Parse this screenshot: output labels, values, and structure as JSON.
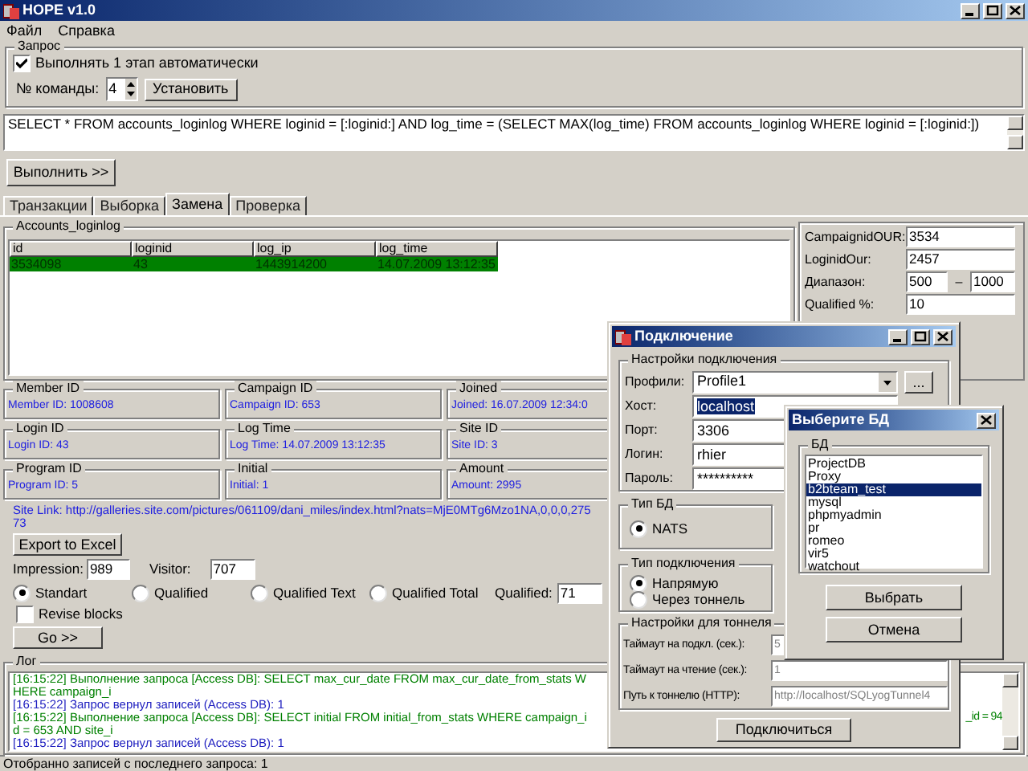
{
  "window": {
    "title": "HOPE v1.0"
  },
  "menu": [
    "Файл",
    "Справка"
  ],
  "query": {
    "group_title": "Запрос",
    "auto_run": {
      "label": "Выполнять 1 этап автоматически",
      "checked": true
    },
    "command_label": "№ команды:",
    "command_value": "4",
    "set_button": "Установить",
    "sql": "SELECT * FROM accounts_loginlog WHERE loginid = [:loginid:] AND log_time = (SELECT MAX(log_time) FROM accounts_loginlog WHERE loginid = [:loginid:])",
    "run_button": "Выполнить >>"
  },
  "tabs": [
    {
      "label": "Транзакции",
      "selected": false
    },
    {
      "label": "Выборка",
      "selected": false
    },
    {
      "label": "Замена",
      "selected": true
    },
    {
      "label": "Проверка",
      "selected": false
    }
  ],
  "table": {
    "title": "Accounts_loginlog",
    "columns": [
      "id",
      "loginid",
      "log_ip",
      "log_time"
    ],
    "rows": [
      {
        "cells": [
          "3534098",
          "43",
          "1443914200",
          "14.07.2009 13:12:35"
        ],
        "selected": true
      }
    ]
  },
  "right_fields": [
    {
      "label": "CampaignidOUR:",
      "value": "3534"
    },
    {
      "label": "LoginidOur:",
      "value": "2457"
    },
    {
      "label": "Диапазон:",
      "value": "500",
      "separator": "–",
      "value2": "1000"
    },
    {
      "label": "Qualified %:",
      "value": "10"
    }
  ],
  "info_groups": [
    {
      "title": "Member ID",
      "text": "Member ID: 1008608"
    },
    {
      "title": "Campaign ID",
      "text": "Campaign ID: 653"
    },
    {
      "title": "Joined",
      "text": "Joined: 16.07.2009 12:34:0"
    },
    {
      "title": "Login ID",
      "text": "Login ID: 43"
    },
    {
      "title": "Log Time",
      "text": "Log Time: 14.07.2009 13:12:35"
    },
    {
      "title": "Site ID",
      "text": "Site ID: 3"
    },
    {
      "title": "Program ID",
      "text": "Program ID: 5"
    },
    {
      "title": "Initial",
      "text": "Initial: 1"
    },
    {
      "title": "Amount",
      "text": "Amount: 2995"
    }
  ],
  "site_link": "Site Link: http://galleries.site.com/pictures/061109/dani_miles/index.html?nats=MjE0MTg6Mzo1NA,0,0,0,27573",
  "export_button": "Export to Excel",
  "impression": {
    "label": "Impression:",
    "value": "989"
  },
  "visitor": {
    "label": "Visitor:",
    "value": "707"
  },
  "modes": [
    {
      "label": "Standart",
      "selected": true
    },
    {
      "label": "Qualified",
      "selected": false
    },
    {
      "label": "Qualified Text",
      "selected": false
    },
    {
      "label": "Qualified Total",
      "selected": false
    }
  ],
  "qualified": {
    "label": "Qualified:",
    "value": "71"
  },
  "revise": {
    "label": "Revise blocks",
    "checked": false
  },
  "go_button": "Go >>",
  "log": {
    "title": "Лог",
    "lines": [
      {
        "kind": "query",
        "text": "[16:15:22] Выполнение запроса [Access DB]: SELECT max_cur_date FROM max_cur_date_from_stats WHERE campaign_i"
      },
      {
        "kind": "result",
        "text": "[16:15:22] Запрос вернул записей (Access DB): 1"
      },
      {
        "kind": "query",
        "text": "[16:15:22] Выполнение запроса [Access DB]: SELECT initial FROM initial_from_stats WHERE campaign_id = 653 AND site_i",
        "tail": "_id = 94"
      },
      {
        "kind": "result",
        "text": "[16:15:22] Запрос вернул записей (Access DB): 1"
      }
    ]
  },
  "status_bar": "Отобранно записей с последнего запроса: 1",
  "connect_dialog": {
    "title": "Подключение",
    "settings_title": "Настройки подключения",
    "fields": [
      {
        "label": "Профили:",
        "value": "Profile1",
        "kind": "combo",
        "selected": false
      },
      {
        "label": "Хост:",
        "value": "localhost",
        "kind": "text",
        "selected": true
      },
      {
        "label": "Порт:",
        "value": "3306",
        "kind": "text",
        "selected": false
      },
      {
        "label": "Логин:",
        "value": "rhier",
        "kind": "text",
        "selected": false
      },
      {
        "label": "Пароль:",
        "value": "**********",
        "kind": "text",
        "selected": false
      }
    ],
    "browse_button": "...",
    "db_type": {
      "title": "Тип БД",
      "options": [
        {
          "label": "NATS",
          "selected": true
        }
      ]
    },
    "conn_type": {
      "title": "Тип подключения",
      "options": [
        {
          "label": "Напрямую",
          "selected": true
        },
        {
          "label": "Через тоннель",
          "selected": false
        }
      ]
    },
    "tunnel": {
      "title": "Настройки для тоннеля",
      "fields": [
        {
          "label": "Таймаут на подкл. (сек.):",
          "value": "5",
          "disabled": true
        },
        {
          "label": "Таймаут на чтение (сек.):",
          "value": "1",
          "disabled": true
        },
        {
          "label": "Путь к тоннелю (HTTP):",
          "value": "http://localhost/SQLyogTunnel4",
          "disabled": true
        }
      ]
    },
    "connect_button": "Подключиться"
  },
  "db_dialog": {
    "title": "Выберите БД",
    "group_title": "БД",
    "items": [
      {
        "label": "ProjectDB",
        "selected": false
      },
      {
        "label": "Proxy",
        "selected": false
      },
      {
        "label": "b2bteam_test",
        "selected": true
      },
      {
        "label": "mysql",
        "selected": false
      },
      {
        "label": "phpmyadmin",
        "selected": false
      },
      {
        "label": "pr",
        "selected": false
      },
      {
        "label": "romeo",
        "selected": false
      },
      {
        "label": "vir5",
        "selected": false
      },
      {
        "label": "watchout",
        "selected": false
      }
    ],
    "ok_button": "Выбрать",
    "cancel_button": "Отмена"
  }
}
